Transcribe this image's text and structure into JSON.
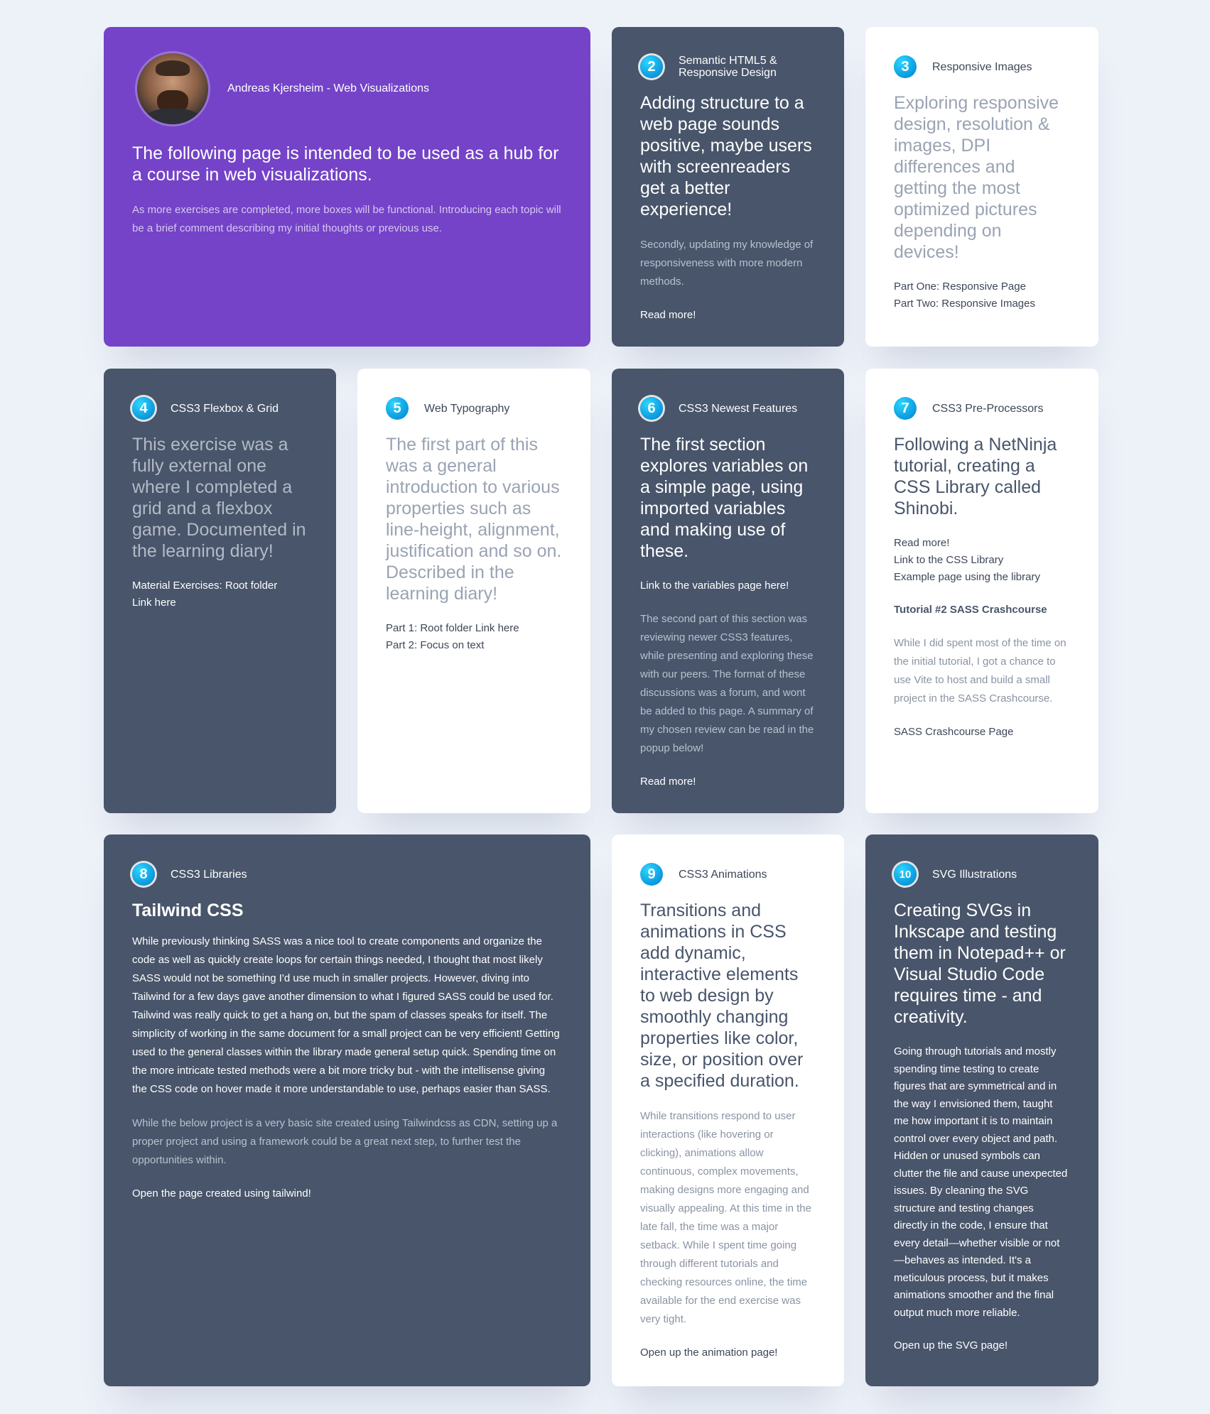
{
  "hub": {
    "author": "Andreas Kjersheim - Web Visualizations",
    "title": "The following page is intended to be used as a hub for a course in web visualizations.",
    "subtitle": "As more exercises are completed, more boxes will be functional. Introducing each topic will be a brief comment describing my initial thoughts or previous use."
  },
  "cards": {
    "c2": {
      "number": "2",
      "topic": "Semantic HTML5 & Responsive Design",
      "headline": "Adding structure to a web page sounds positive, maybe users with screenreaders get a better experience!",
      "text": "Secondly, updating my knowledge of responsiveness with more modern methods.",
      "link": "Read more!"
    },
    "c3": {
      "number": "3",
      "topic": "Responsive Images",
      "headline": "Exploring responsive design, resolution & images, DPI differences and getting the most optimized pictures depending on devices!",
      "link1": "Part One: Responsive Page",
      "link2": "Part Two: Responsive Images"
    },
    "c4": {
      "number": "4",
      "topic": "CSS3 Flexbox & Grid",
      "headline": "This exercise was a fully external one where I completed a grid and a flexbox game. Documented in the learning diary!",
      "link1": "Material Exercises: Root folder",
      "link2": "Link here"
    },
    "c5": {
      "number": "5",
      "topic": "Web Typography",
      "headline": "The first part of this was a general introduction to various properties such as line-height, alignment, justification and so on. Described in the learning diary!",
      "link1": "Part 1: Root folder Link here",
      "link2": "Part 2: Focus on text"
    },
    "c6": {
      "number": "6",
      "topic": "CSS3 Newest Features",
      "headline": "The first section explores variables on a simple page, using imported variables and making use of these.",
      "link1": "Link to the variables page here!",
      "text": "The second part of this section was reviewing newer CSS3 features, while presenting and exploring these with our peers. The format of these discussions was a forum, and wont be added to this page. A summary of my chosen review can be read in the popup below!",
      "link2": "Read more!"
    },
    "c7": {
      "number": "7",
      "topic": "CSS3 Pre-Processors",
      "headline": "Following a NetNinja tutorial, creating a CSS Library called Shinobi.",
      "link1": "Read more!",
      "link2": "Link to the CSS Library",
      "link3": "Example page using the library",
      "subheading": "Tutorial #2 SASS Crashcourse",
      "text": "While I did spent most of the time on the initial tutorial, I got a chance to use Vite to host and build a small project in the SASS Crashcourse.",
      "link4": "SASS Crashcourse Page"
    },
    "c8": {
      "number": "8",
      "topic": "CSS3 Libraries",
      "title": "Tailwind CSS",
      "text1": "While previously thinking SASS was a nice tool to create components and organize the code as well as quickly create loops for certain things needed, I thought that most likely SASS would not be something I'd use much in smaller projects. However, diving into Tailwind for a few days gave another dimension to what I figured SASS could be used for. Tailwind was really quick to get a hang on, but the spam of classes speaks for itself. The simplicity of working in the same document for a small project can be very efficient! Getting used to the general classes within the library made general setup quick. Spending time on the more intricate tested methods were a bit more tricky but - with the intellisense giving the CSS code on hover made it more understandable to use, perhaps easier than SASS.",
      "text2": "While the below project is a very basic site created using Tailwindcss as CDN, setting up a proper project and using a framework could be a great next step, to further test the opportunities within.",
      "link": "Open the page created using tailwind!"
    },
    "c9": {
      "number": "9",
      "topic": "CSS3 Animations",
      "headline": "Transitions and animations in CSS add dynamic, interactive elements to web design by smoothly changing properties like color, size, or position over a specified duration.",
      "text": "While transitions respond to user interactions (like hovering or clicking), animations allow continuous, complex movements, making designs more engaging and visually appealing. At this time in the late fall, the time was a major setback. While I spent time going through different tutorials and checking resources online, the time available for the end exercise was very tight.",
      "link": "Open up the animation page!"
    },
    "c10": {
      "number": "10",
      "topic": "SVG Illustrations",
      "headline": "Creating SVGs in Inkscape and testing them in Notepad++ or Visual Studio Code requires time - and creativity.",
      "text": "Going through tutorials and mostly spending time testing to create figures that are symmetrical and in the way I envisioned them, taught me how important it is to maintain control over every object and path. Hidden or unused symbols can clutter the file and cause unexpected issues. By cleaning the SVG structure and testing changes directly in the code, I ensure that every detail—whether visible or not—behaves as intended. It's a meticulous process, but it makes animations smoother and the final output much more reliable.",
      "link": "Open up the SVG page!"
    }
  },
  "colors": {
    "background": "#edf1f8",
    "purple": "#7443c8",
    "slate": "#48556a",
    "white": "#ffffff",
    "badge": "#10a6e4"
  }
}
